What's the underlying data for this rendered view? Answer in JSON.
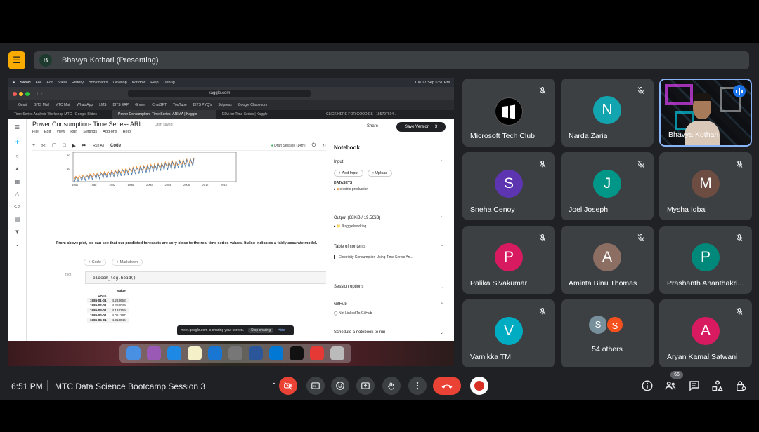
{
  "meeting": {
    "presenter_initial": "B",
    "presenter_label": "Bhavya Kothari (Presenting)",
    "time": "6:51 PM",
    "title": "MTC Data Science Bootcamp Session 3",
    "participant_count": "66"
  },
  "shared_screen": {
    "mac_menu": [
      "Safari",
      "File",
      "Edit",
      "View",
      "History",
      "Bookmarks",
      "Develop",
      "Window",
      "Help",
      "Debug"
    ],
    "mac_status": "Tue 17 Sep 6:51 PM",
    "url": "kaggle.com",
    "bookmarks": [
      "Gmail",
      "BITS Mail",
      "MTC Mail",
      "WhatsApp",
      "LMS",
      "BITS ERP",
      "Gmeet",
      "ChatGPT",
      "YouTube",
      "BITS PYQ's",
      "Solpress",
      "Google Classroom"
    ],
    "browser_tabs": [
      {
        "label": "Time Series Analysis Workshop MTC - Google Slides",
        "active": false
      },
      {
        "label": "Power Consumption- Time Series- ARIMA | Kaggle",
        "active": true
      },
      {
        "label": "EDA for Time Series | Kaggle",
        "active": false
      },
      {
        "label": "CLICK HERE FOR GOODIES - 155797604...",
        "active": false
      }
    ],
    "kaggle": {
      "notebook_title": "Power Consumption- Time Series- ARI...",
      "draft_status": "Draft saved",
      "menu": [
        "File",
        "Edit",
        "View",
        "Run",
        "Settings",
        "Add-ons",
        "Help"
      ],
      "share_label": "Share",
      "save_version_label": "Save Version",
      "save_version_count": "3",
      "run_all_label": "Run All",
      "cell_type": "Code",
      "session_label": "Draft Session (14m)",
      "chart_x_ticks": [
        "1984",
        "1988",
        "1992",
        "1996",
        "2000",
        "2004",
        "2008",
        "2012",
        "2016"
      ],
      "chart_y_ticks": [
        "80",
        "60"
      ],
      "markdown_text": "From above plot, we can see that our predicted forecasts are very close to the real time series values. It also indicates a fairly accurate model.",
      "add_code_label": "+ Code",
      "add_markdown_label": "+ Markdown",
      "in_count": "[36]:",
      "code": "elecom_log.head()",
      "table": {
        "col_header": "Value",
        "index_header": "DATE",
        "rows": [
          {
            "date": "1985-01-01",
            "value": "4.283658"
          },
          {
            "date": "1985-02-01",
            "value": "4.258049"
          },
          {
            "date": "1985-03-01",
            "value": "4.134369"
          },
          {
            "date": "1985-04-01",
            "value": "4.051287"
          },
          {
            "date": "1985-05-01",
            "value": "4.013046"
          }
        ]
      },
      "sidebar": {
        "heading": "Notebook",
        "input_label": "Input",
        "add_input_label": "Add Input",
        "upload_label": "Upload",
        "datasets_label": "DATASETS",
        "dataset_name": "electric-production",
        "output_label": "Output (68KiB / 19.5GiB)",
        "output_path": "/kaggle/working",
        "toc_label": "Table of contents",
        "toc_item": "Electricity Consumption Using Time Series An...",
        "session_options_label": "Session options",
        "github_label": "GitHub",
        "github_status": "Not Linked To GitHub",
        "schedule_label": "Schedule a notebook to run"
      }
    },
    "share_notice": {
      "text": "meet.google.com is sharing your screen.",
      "stop_label": "Stop sharing",
      "hide_label": "Hide"
    }
  },
  "tiles": [
    {
      "name": "Microsoft Tech Club",
      "initial": "",
      "color": "#000000",
      "type": "logo"
    },
    {
      "name": "Narda Zaria",
      "initial": "N",
      "color": "#12a4af",
      "type": "avatar"
    },
    {
      "name": "Bhavya Kothari",
      "initial": "",
      "color": "#1b1d22",
      "type": "video"
    },
    {
      "name": "Sneha Cenoy",
      "initial": "S",
      "color": "#5e35b1",
      "type": "avatar"
    },
    {
      "name": "Joel Joseph",
      "initial": "J",
      "color": "#009688",
      "type": "avatar"
    },
    {
      "name": "Mysha Iqbal",
      "initial": "M",
      "color": "#6d4c41",
      "type": "avatar"
    },
    {
      "name": "Palika Sivakumar",
      "initial": "P",
      "color": "#d81b60",
      "type": "avatar"
    },
    {
      "name": "Aminta Binu Thomas",
      "initial": "A",
      "color": "#8d6e63",
      "type": "avatar"
    },
    {
      "name": "Prashanth Ananthakri...",
      "initial": "P",
      "color": "#00897b",
      "type": "avatar"
    },
    {
      "name": "Varnikka TM",
      "initial": "V",
      "color": "#00acc1",
      "type": "avatar"
    },
    {
      "name": "54 others",
      "initial": "",
      "color": "#3c4043",
      "type": "others"
    },
    {
      "name": "Aryan Kamal Satwani",
      "initial": "A",
      "color": "#d81b60",
      "type": "avatar"
    }
  ],
  "icons": {
    "mic_off": "mic-off-icon",
    "camera_off": "camera-off-icon",
    "captions": "captions-icon",
    "emoji": "emoji-icon",
    "present": "present-icon",
    "raise_hand": "raise-hand-icon",
    "more": "more-icon",
    "end_call": "end-call-icon",
    "record": "record-icon",
    "info": "info-icon",
    "people": "people-icon",
    "chat": "chat-icon",
    "activities": "activities-icon",
    "host_controls": "host-controls-icon"
  },
  "colors": {
    "meet_bg": "#202124",
    "tile_bg": "#3c4043",
    "end_call": "#ea4335",
    "accent": "#8ab4f8",
    "others_s": "#78909c",
    "others_s2": "#f4511e"
  }
}
